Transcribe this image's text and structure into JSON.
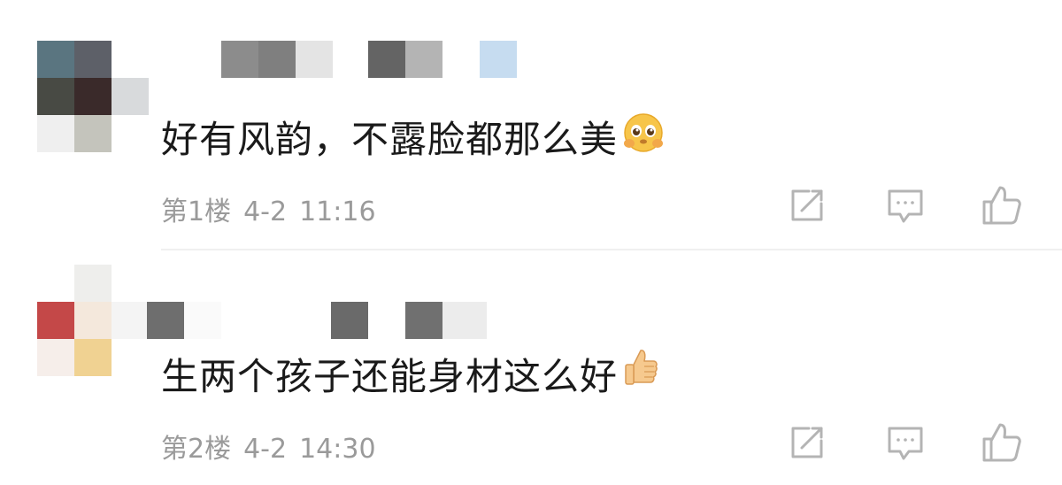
{
  "comments": [
    {
      "text": "好有风韵，不露脸都那么美",
      "emoji": "pleading-face-emoji",
      "floor": "第1楼",
      "date": "4-2",
      "time": "11:16"
    },
    {
      "text": "生两个孩子还能身材这么好",
      "emoji": "thumbs-up-emoji",
      "floor": "第2楼",
      "date": "4-2",
      "time": "14:30"
    }
  ],
  "icons": {
    "share": "share-icon",
    "reply": "reply-icon",
    "like": "like-icon"
  },
  "colors": {
    "text": "#1a1a1a",
    "meta": "#9a9a9a",
    "icon": "#b4b4b4",
    "divider": "#f0f0f0"
  }
}
